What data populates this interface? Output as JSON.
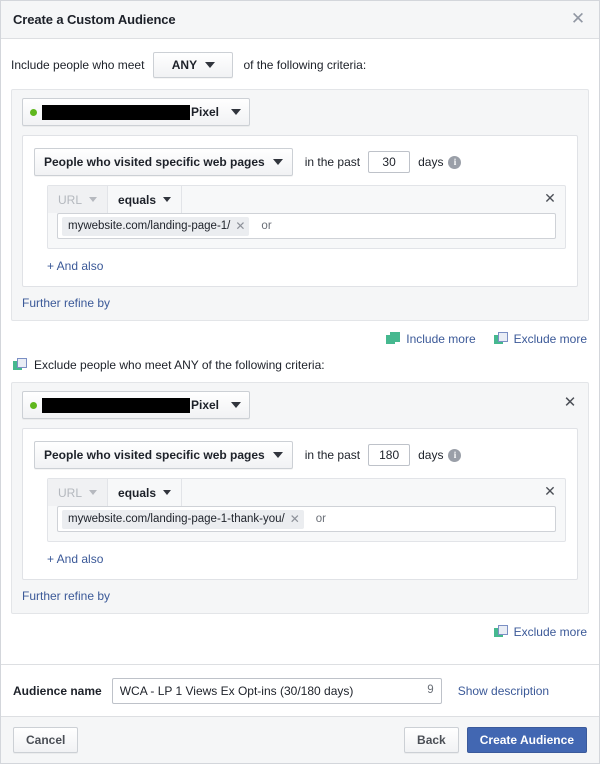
{
  "dialog": {
    "title": "Create a Custom Audience",
    "close_icon": "close-icon"
  },
  "include": {
    "prefix_label": "Include people who meet",
    "match_selector_value": "ANY",
    "suffix_label": "of the following criteria:",
    "pixel_label": "Pixel",
    "rule": {
      "event_label": "People who visited specific web pages",
      "in_the_past_label": "in the past",
      "days_value": "30",
      "days_label": "days",
      "info_icon": "info-icon",
      "field_label": "URL",
      "operator_label": "equals",
      "token_value": "mywebsite.com/landing-page-1/",
      "or_label": "or"
    },
    "and_also_label": "+ And also",
    "further_refine_label": "Further refine by"
  },
  "more_links": {
    "include_more": "Include more",
    "exclude_more": "Exclude more"
  },
  "exclude": {
    "heading": "Exclude people who meet ANY of the following criteria:",
    "pixel_label": "Pixel",
    "rule": {
      "event_label": "People who visited specific web pages",
      "in_the_past_label": "in the past",
      "days_value": "180",
      "days_label": "days",
      "info_icon": "info-icon",
      "field_label": "URL",
      "operator_label": "equals",
      "token_value": "mywebsite.com/landing-page-1-thank-you/",
      "or_label": "or"
    },
    "and_also_label": "+ And also",
    "further_refine_label": "Further refine by",
    "exclude_more": "Exclude more"
  },
  "audience": {
    "name_label": "Audience name",
    "name_value": "WCA - LP 1 Views Ex Opt-ins (30/180 days)",
    "name_placeholder": "Audience name",
    "char_count": "9",
    "show_description_label": "Show description"
  },
  "footer": {
    "cancel_label": "Cancel",
    "back_label": "Back",
    "create_label": "Create Audience"
  },
  "colors": {
    "primary_button": "#4267b2",
    "link": "#3b5998",
    "pixel_status_dot": "#5fb71d",
    "include_icon": "#46b88f"
  }
}
